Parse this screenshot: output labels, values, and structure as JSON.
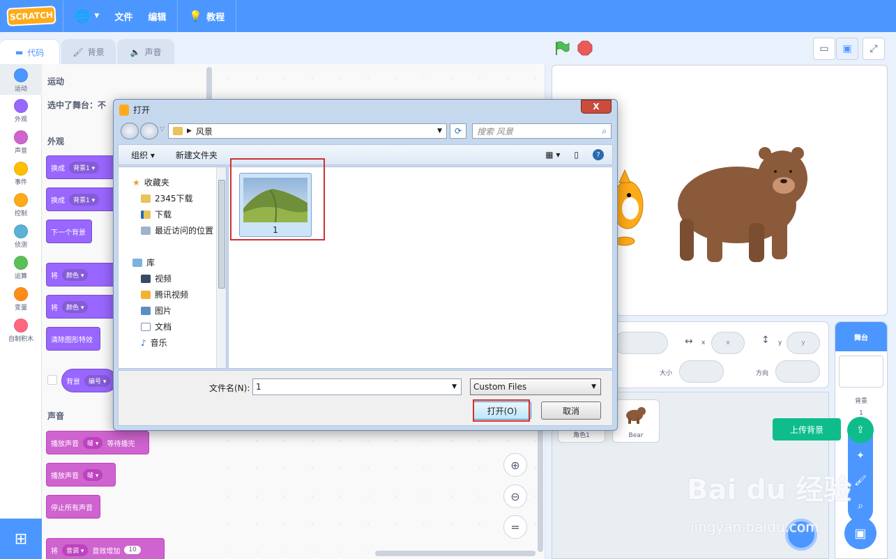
{
  "menubar": {
    "logo": "SCRATCH",
    "file": "文件",
    "edit": "编辑",
    "tutorials": "教程"
  },
  "tabs": [
    {
      "label": "代码"
    },
    {
      "label": "背景"
    },
    {
      "label": "声音"
    }
  ],
  "categories": [
    {
      "label": "运动",
      "color": "#4c97ff"
    },
    {
      "label": "外观",
      "color": "#9966ff"
    },
    {
      "label": "声音",
      "color": "#cf63cf"
    },
    {
      "label": "事件",
      "color": "#ffbf00"
    },
    {
      "label": "控制",
      "color": "#ffab19"
    },
    {
      "label": "侦测",
      "color": "#5cb1d6"
    },
    {
      "label": "运算",
      "color": "#59c059"
    },
    {
      "label": "变量",
      "color": "#ff8c1a"
    },
    {
      "label": "自制积木",
      "color": "#ff6680"
    }
  ],
  "palette": {
    "motion_heading": "运动",
    "motion_note": "选中了舞台：不",
    "looks_heading": "外观",
    "switch_label": "换成",
    "backdrop1": "背景1",
    "next_backdrop": "下一个背景",
    "set_label": "将",
    "color": "颜色",
    "clear_effects": "清除图形特效",
    "backdrop_label": "背景",
    "number": "编号",
    "sound_heading": "声音",
    "play_until_done": "播放声音",
    "pop": "啵",
    "until_done": "等待播完",
    "play_sound": "播放声音",
    "stop_all": "停止所有声音",
    "pitch": "音调",
    "effect_increase": "音效增加",
    "ten": "10"
  },
  "stage_pane": {
    "header": "舞台",
    "backdrops_label": "背景",
    "backdrops_count": "1",
    "upload_tooltip": "上传背景"
  },
  "sprite_info": {
    "x_label": "x",
    "y_label": "y",
    "x_placeholder": "x",
    "y_placeholder": "y",
    "size_label": "大小",
    "direction_label": "方向"
  },
  "sprites": [
    {
      "name": "角色1"
    },
    {
      "name": "Bear"
    }
  ],
  "dialog": {
    "title": "打开",
    "path": "风景",
    "search_placeholder": "搜索 风景",
    "organize": "组织",
    "new_folder": "新建文件夹",
    "nav": [
      {
        "label": "收藏夹",
        "icon": "star-icon"
      },
      {
        "label": "2345下载",
        "icon": "folder-icon"
      },
      {
        "label": "下载",
        "icon": "download-folder-icon"
      },
      {
        "label": "最近访问的位置",
        "icon": "recent-places-icon"
      },
      {
        "label": "库",
        "icon": "library-icon"
      },
      {
        "label": "视频",
        "icon": "video-icon"
      },
      {
        "label": "腾讯视频",
        "icon": "folder-icon"
      },
      {
        "label": "图片",
        "icon": "picture-icon"
      },
      {
        "label": "文档",
        "icon": "document-icon"
      },
      {
        "label": "音乐",
        "icon": "music-icon"
      }
    ],
    "file": {
      "name": "1"
    },
    "filename_label": "文件名(N):",
    "filename_value": "1",
    "filetype": "Custom Files",
    "open_button": "打开(O)",
    "cancel_button": "取消",
    "close_glyph": "X"
  },
  "watermark": {
    "brand": "Bai du 经验",
    "url": "jingyan.baidu.com"
  },
  "colors": {
    "scratch_blue": "#4c97ff",
    "highlight_red": "#d0302f",
    "upload_green": "#0fbd8c"
  }
}
